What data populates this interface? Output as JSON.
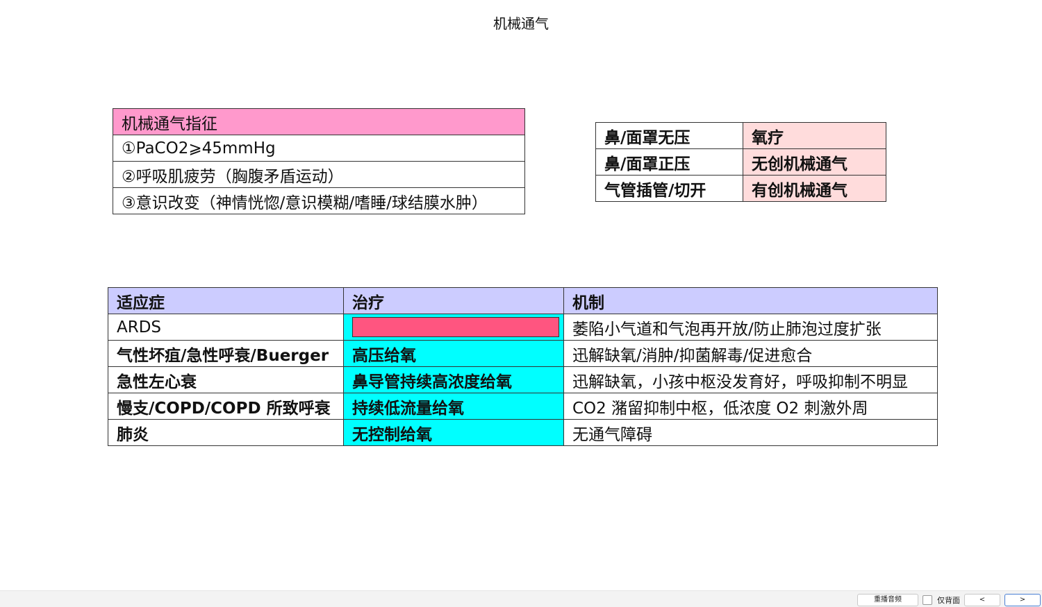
{
  "page": {
    "title": "机械通气"
  },
  "indications_table": {
    "header": "机械通气指征",
    "items": [
      "①PaCO2⩾45mmHg",
      "②呼吸肌疲劳（胸腹矛盾运动）",
      "③意识改变（神情恍惚/意识模糊/嗜睡/球结膜水肿）"
    ],
    "header_color": "#ff99cc"
  },
  "oxygen_modes_table": {
    "rows": [
      {
        "mode": "鼻/面罩无压",
        "therapy": "氧疗"
      },
      {
        "mode": "鼻/面罩正压",
        "therapy": "无创机械通气"
      },
      {
        "mode": "气管插管/切开",
        "therapy": "有创机械通气"
      }
    ],
    "therapy_color": "#ffdcdc"
  },
  "treatment_table": {
    "headers": {
      "indication": "适应症",
      "treatment": "治疗",
      "mechanism": "机制"
    },
    "rows": [
      {
        "indication": "ARDS",
        "treatment": "",
        "mechanism": "萎陷小气道和气泡再开放/防止肺泡过度扩张"
      },
      {
        "indication": "气性坏疽/急性呼衰/Buerger",
        "treatment": "高压给氧",
        "mechanism": "迅解缺氧/消肿/抑菌解毒/促进愈合"
      },
      {
        "indication": "急性左心衰",
        "treatment": "鼻导管持续高浓度给氧",
        "mechanism": "迅解缺氧，小孩中枢没发育好，呼吸抑制不明显"
      },
      {
        "indication": "慢支/COPD/COPD 所致呼衰",
        "treatment": "持续低流量给氧",
        "mechanism": "CO2 潴留抑制中枢，低浓度 O2 刺激外周"
      },
      {
        "indication": "肺炎",
        "treatment": "无控制给氧",
        "mechanism": "无通气障碍"
      }
    ],
    "header_color": "#ccccff",
    "treatment_color": "#00ffff",
    "hidden_answer_color": "#ff5580"
  },
  "toolbar": {
    "replay_label": "重播音频",
    "back_only_label": "仅背面",
    "prev_label": "<",
    "next_label": ">"
  }
}
